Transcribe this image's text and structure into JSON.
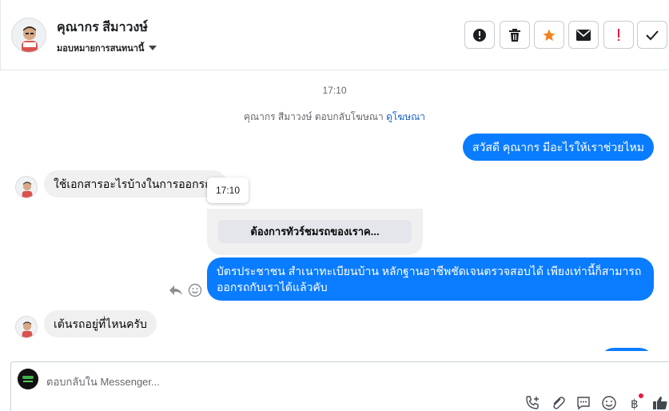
{
  "header": {
    "contact_name": "คุณากร สีมาวงษ์",
    "assign_label": "มอบหมายการสนทนานี้",
    "toolbar": [
      {
        "name": "spam-button",
        "icon": "alert-circle-icon"
      },
      {
        "name": "delete-button",
        "icon": "trash-icon"
      },
      {
        "name": "star-button",
        "icon": "star-icon",
        "color": "#f5821f"
      },
      {
        "name": "mail-button",
        "icon": "envelope-icon"
      },
      {
        "name": "follow-up-button",
        "icon": "exclamation-icon",
        "color": "#e41e3f"
      },
      {
        "name": "done-button",
        "icon": "checkmark-icon"
      }
    ]
  },
  "chat": {
    "timestamp": "17:10",
    "system_text": "คุณากร สีมาวงษ์ ตอบกลับโฆษณา",
    "system_link": "ดูโฆษณา",
    "messages": [
      {
        "from": "page",
        "text": "สวัสดี คุณากร มีอะไรให้เราช่วยไหม"
      },
      {
        "from": "user",
        "text": "ใช้เอกสารอะไรบ้างในการออกรถ?"
      },
      {
        "from": "page",
        "text": "บัตรประชาชน สำเนาทะเบียนบ้าน หลักฐานอาชีพชัดเจนตรวจสอบได้ เพียงเท่านี้ก็สามารถออกรถกับเราได้แล้วคับ"
      },
      {
        "from": "user",
        "text": "เต้นรถอยู่ที่ไหนครับ"
      }
    ],
    "tooltip_time": "17:10",
    "card_button": "ต้องการทัวร์ชมรถของเราค..."
  },
  "composer": {
    "placeholder": "ตอบกลับใน Messenger...",
    "icons": [
      "phone-add-icon",
      "paperclip-icon",
      "chat-bubble-icon",
      "emoji-icon",
      "baht-icon",
      "thumbs-up-icon"
    ]
  },
  "colors": {
    "accent_blue": "#0a7cff",
    "bubble_gray": "#f0f0f0",
    "link_blue": "#1763cf"
  }
}
